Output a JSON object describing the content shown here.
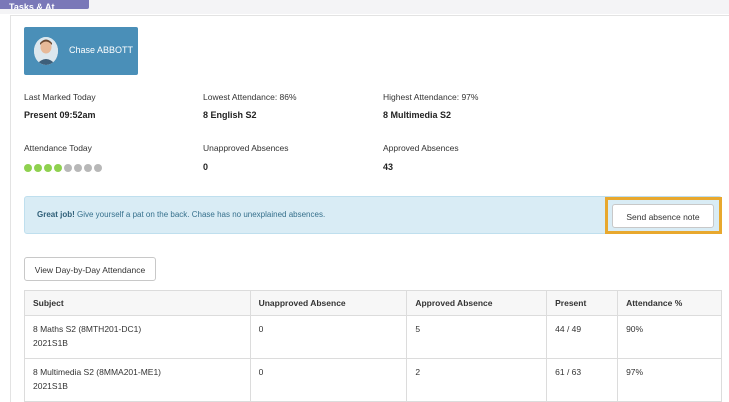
{
  "header": {
    "tab_label": "Tasks & At"
  },
  "student": {
    "name": "Chase ABBOTT",
    "card_color": "#4a8fb8"
  },
  "stats": [
    {
      "label": "Last Marked Today",
      "value": "Present 09:52am"
    },
    {
      "label": "Lowest Attendance: 86%",
      "value": "8 English S2"
    },
    {
      "label": "Highest Attendance: 97%",
      "value": "8 Multimedia S2"
    },
    {
      "label": "Attendance Today",
      "value": ""
    },
    {
      "label": "Unapproved Absences",
      "value": "0"
    },
    {
      "label": "Approved Absences",
      "value": "43"
    }
  ],
  "attendance_today": {
    "present_periods": 4,
    "total_periods": 8,
    "present_color": "#8fd14f",
    "other_color": "#b8b8b8"
  },
  "alert": {
    "strong": "Great job!",
    "message": " Give yourself a pat on the back. Chase has no unexplained absences.",
    "send_button": "Send absence note",
    "highlight_color": "#e8a82e"
  },
  "day_by_day_button": "View Day-by-Day Attendance",
  "table": {
    "headers": [
      "Subject",
      "Unapproved Absence",
      "Approved Absence",
      "Present",
      "Attendance %"
    ],
    "rows": [
      {
        "subject": "8 Maths S2 (8MTH201-DC1)",
        "period": "2021S1B",
        "unapproved": "0",
        "approved": "5",
        "present": "44 / 49",
        "percent": "90%"
      },
      {
        "subject": "8 Multimedia S2 (8MMA201-ME1)",
        "period": "2021S1B",
        "unapproved": "0",
        "approved": "2",
        "present": "61 / 63",
        "percent": "97%"
      }
    ]
  }
}
